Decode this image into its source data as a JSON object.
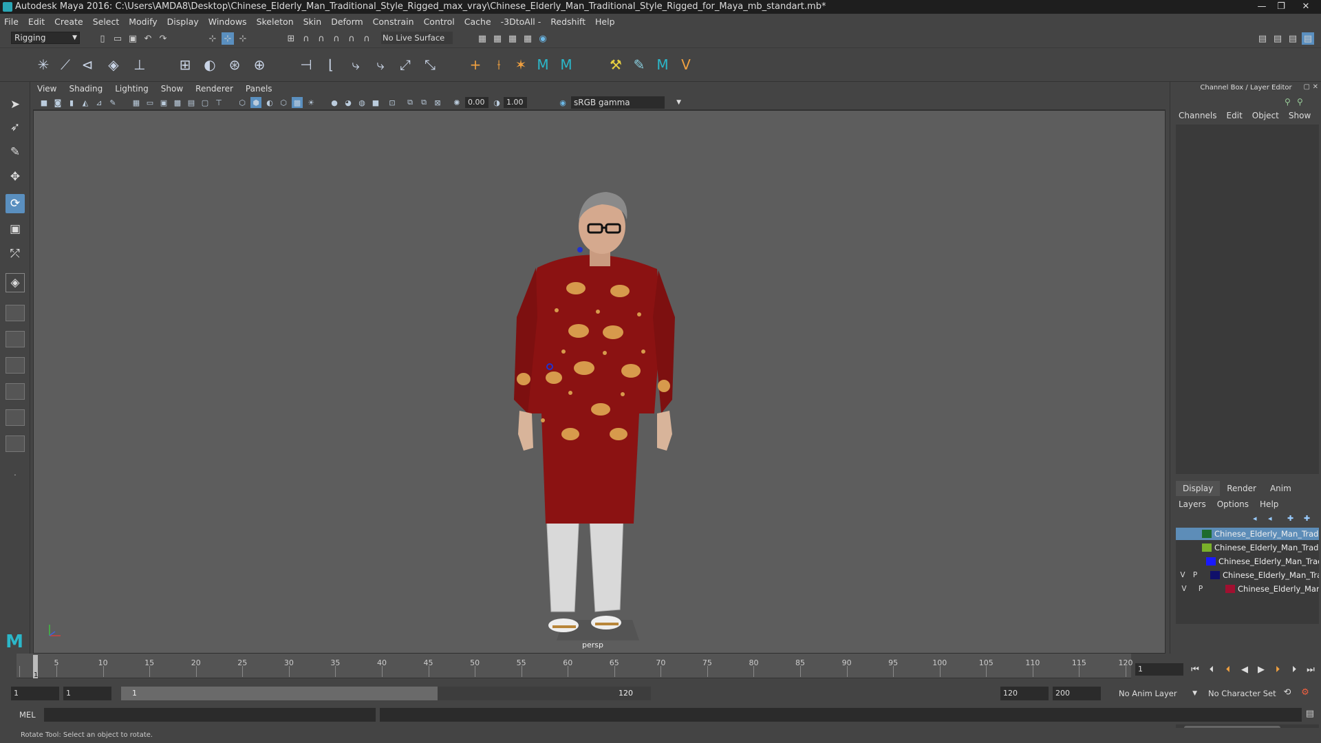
{
  "window": {
    "title": "Autodesk Maya 2016: C:\\Users\\AMDA8\\Desktop\\Chinese_Elderly_Man_Traditional_Style_Rigged_max_vray\\Chinese_Elderly_Man_Traditional_Style_Rigged_for_Maya_mb_standart.mb*",
    "minimize": "—",
    "maximize": "❐",
    "close": "✕"
  },
  "menubar": [
    "File",
    "Edit",
    "Create",
    "Select",
    "Modify",
    "Display",
    "Windows",
    "Skeleton",
    "Skin",
    "Deform",
    "Constrain",
    "Control",
    "Cache",
    "-3DtoAll -",
    "Redshift",
    "Help"
  ],
  "status": {
    "mode": "Rigging",
    "live_surface": "No Live Surface"
  },
  "viewport": {
    "menu": [
      "View",
      "Shading",
      "Lighting",
      "Show",
      "Renderer",
      "Panels"
    ],
    "exposure": "0.00",
    "gamma": "1.00",
    "colorspace": "sRGB gamma",
    "camera": "persp"
  },
  "right_panel": {
    "title": "Channel Box / Layer Editor",
    "tabs": [
      "Channels",
      "Edit",
      "Object",
      "Show"
    ],
    "layer_tabs": [
      "Display",
      "Render",
      "Anim"
    ],
    "layer_menu": [
      "Layers",
      "Options",
      "Help"
    ],
    "layers": [
      {
        "v": "",
        "p": "",
        "name": "Chinese_Elderly_Man_Traditional_Style_Rigged_controllers",
        "color": "#1e6b2e",
        "selected": true
      },
      {
        "v": "",
        "p": "",
        "name": "Chinese_Elderly_Man_Traditional_Style_Rigged_bones",
        "color": "#7ab02a",
        "selected": false
      },
      {
        "v": "",
        "p": "",
        "name": "Chinese_Elderly_Man_Traditional_Style_Rigged_helpers",
        "color": "#1a1aff",
        "selected": false
      },
      {
        "v": "V",
        "p": "P",
        "name": "Chinese_Elderly_Man_Traditional_Style_Rigged_geometry",
        "color": "#10106a",
        "selected": false
      },
      {
        "v": "V",
        "p": "P",
        "name": "Chinese_Elderly_Man_Traditional_Style_Rigged",
        "color": "#a01030",
        "selected": false
      }
    ]
  },
  "timeline": {
    "ticks": [
      "1",
      "5",
      "10",
      "15",
      "20",
      "25",
      "30",
      "35",
      "40",
      "45",
      "50",
      "55",
      "60",
      "65",
      "70",
      "75",
      "80",
      "85",
      "90",
      "95",
      "100",
      "105",
      "110",
      "115",
      "120"
    ],
    "current_frame": "1",
    "current_frame_field": "1"
  },
  "range": {
    "start": "1",
    "playback_start": "1",
    "slider_start": "1",
    "slider_end": "120",
    "playback_end": "120",
    "end": "200",
    "anim_layer": "No Anim Layer",
    "character_set": "No Character Set"
  },
  "cmdline": {
    "label": "MEL"
  },
  "helpline": "Rotate Tool: Select an object to rotate."
}
